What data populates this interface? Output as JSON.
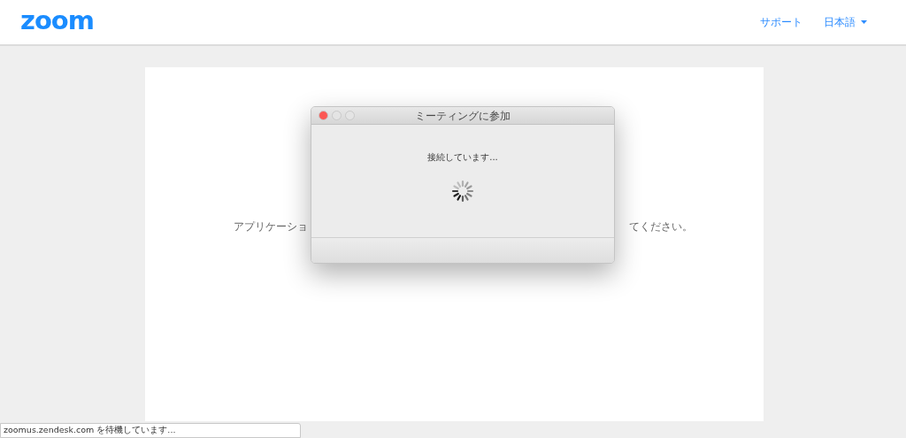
{
  "header": {
    "logo": "zoom",
    "nav": [
      {
        "label": "サポート",
        "kind": "link"
      },
      {
        "label": "日本語",
        "kind": "dropdown"
      }
    ]
  },
  "page": {
    "message_left": "アプリケーショ",
    "message_right": "てください。"
  },
  "dialog": {
    "title": "ミーティングに参加",
    "message": "接続しています..."
  },
  "status_bar": {
    "text": "zoomus.zendesk.com を待機しています..."
  }
}
